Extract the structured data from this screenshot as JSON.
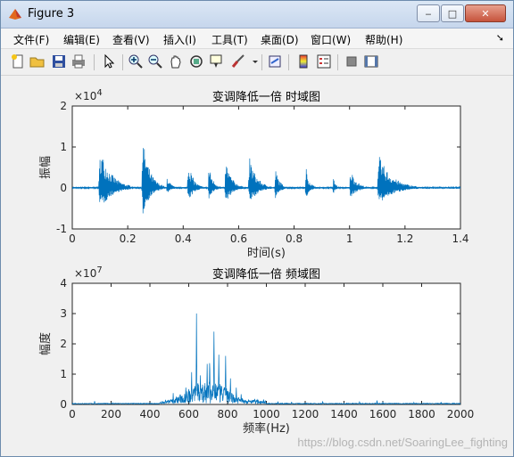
{
  "window": {
    "title": "Figure 3",
    "controls": {
      "minimize": "‒",
      "maximize": "□",
      "close": "✕"
    }
  },
  "menubar": {
    "items": [
      "文件(F)",
      "编辑(E)",
      "查看(V)",
      "插入(I)",
      "工具(T)",
      "桌面(D)",
      "窗口(W)",
      "帮助(H)"
    ]
  },
  "toolbar": {
    "icons": [
      "new-figure-icon",
      "open-file-icon",
      "save-icon",
      "print-icon",
      "pointer-icon",
      "zoom-in-icon",
      "zoom-out-icon",
      "pan-icon",
      "rotate-icon",
      "data-cursor-icon",
      "brush-icon",
      "link-icon",
      "colorbar-icon",
      "legend-icon",
      "hide-plot-tools-icon",
      "show-plot-tools-icon"
    ]
  },
  "colors": {
    "line": "#0072bd",
    "axes_bg": "#ffffff",
    "figure_bg": "#f0f0f0"
  },
  "watermark": "https://blog.csdn.net/SoaringLee_fighting",
  "chart_data": [
    {
      "type": "line",
      "title": "变调降低一倍 时域图",
      "xlabel": "时间(s)",
      "ylabel": "振幅",
      "xlim": [
        0,
        1.4
      ],
      "ylim": [
        -10000,
        20000
      ],
      "y_exponent_label": "×10",
      "y_exponent": "4",
      "xticks": [
        "0",
        "0.2",
        "0.4",
        "0.6",
        "0.8",
        "1",
        "1.2",
        "1.4"
      ],
      "yticks": [
        "-1",
        "0",
        "1",
        "2"
      ],
      "grid": false,
      "bursts": [
        {
          "t0": 0.095,
          "t1": 0.22,
          "peak": 11500
        },
        {
          "t0": 0.25,
          "t1": 0.33,
          "peak": 14500
        },
        {
          "t0": 0.34,
          "t1": 0.38,
          "peak": 3500
        },
        {
          "t0": 0.415,
          "t1": 0.47,
          "peak": 8500
        },
        {
          "t0": 0.49,
          "t1": 0.54,
          "peak": 6500
        },
        {
          "t0": 0.55,
          "t1": 0.62,
          "peak": 8000
        },
        {
          "t0": 0.635,
          "t1": 0.72,
          "peak": 8800
        },
        {
          "t0": 0.73,
          "t1": 0.78,
          "peak": 5500
        },
        {
          "t0": 0.84,
          "t1": 0.88,
          "peak": 6500
        },
        {
          "t0": 0.94,
          "t1": 0.97,
          "peak": 3000
        },
        {
          "t0": 1.0,
          "t1": 1.07,
          "peak": 5500
        },
        {
          "t0": 1.1,
          "t1": 1.25,
          "peak": 9000
        }
      ]
    },
    {
      "type": "line",
      "title": "变调降低一倍 频域图",
      "xlabel": "频率(Hz)",
      "ylabel": "幅度",
      "xlim": [
        0,
        2000
      ],
      "ylim": [
        0,
        40000000
      ],
      "y_exponent_label": "×10",
      "y_exponent": "7",
      "xticks": [
        "0",
        "200",
        "400",
        "600",
        "800",
        "1000",
        "1200",
        "1400",
        "1600",
        "1800",
        "2000"
      ],
      "yticks": [
        "0",
        "1",
        "2",
        "3",
        "4"
      ],
      "grid": false,
      "peaks": [
        {
          "f": 115,
          "v": 1300000
        },
        {
          "f": 210,
          "v": 600000
        },
        {
          "f": 480,
          "v": 1800000
        },
        {
          "f": 520,
          "v": 3800000
        },
        {
          "f": 585,
          "v": 6500000
        },
        {
          "f": 615,
          "v": 11500000
        },
        {
          "f": 635,
          "v": 3500000
        },
        {
          "f": 640,
          "v": 32000000
        },
        {
          "f": 660,
          "v": 10000000
        },
        {
          "f": 695,
          "v": 14000000
        },
        {
          "f": 708,
          "v": 19000000
        },
        {
          "f": 730,
          "v": 30000000
        },
        {
          "f": 755,
          "v": 18000000
        },
        {
          "f": 790,
          "v": 19000000
        },
        {
          "f": 815,
          "v": 9000000
        },
        {
          "f": 845,
          "v": 6000000
        },
        {
          "f": 870,
          "v": 3500000
        },
        {
          "f": 940,
          "v": 2000000
        },
        {
          "f": 1060,
          "v": 1000000
        },
        {
          "f": 1130,
          "v": 900000
        },
        {
          "f": 1290,
          "v": 1200000
        },
        {
          "f": 1480,
          "v": 1000000
        },
        {
          "f": 1570,
          "v": 1500000
        },
        {
          "f": 1600,
          "v": 800000
        },
        {
          "f": 1760,
          "v": 700000
        },
        {
          "f": 1900,
          "v": 800000
        }
      ]
    }
  ]
}
